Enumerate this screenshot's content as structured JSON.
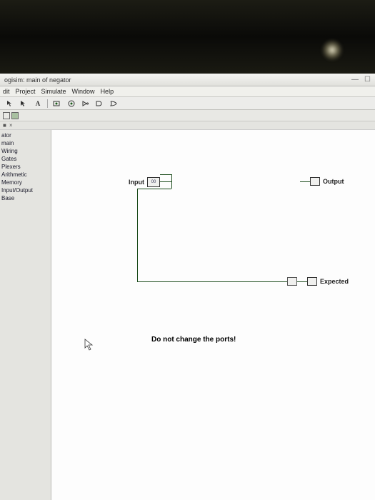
{
  "title": "ogisim: main of negator",
  "menu": {
    "edit": "dit",
    "project": "Project",
    "simulate": "Simulate",
    "window": "Window",
    "help": "Help"
  },
  "toolbar": {
    "a_icon": "A"
  },
  "sidebar": {
    "items": [
      "ator",
      "main",
      "Wiring",
      "Gates",
      "Plexers",
      "Arithmetic",
      "Memory",
      "Input/Output",
      "Base"
    ]
  },
  "circuit": {
    "input_label": "Input",
    "output_label": "Output",
    "expected_label": "Expected",
    "pin_content": "00",
    "caption": "Do not change the ports!"
  },
  "titlebar_controls": {
    "min": "—",
    "close": "☐"
  }
}
